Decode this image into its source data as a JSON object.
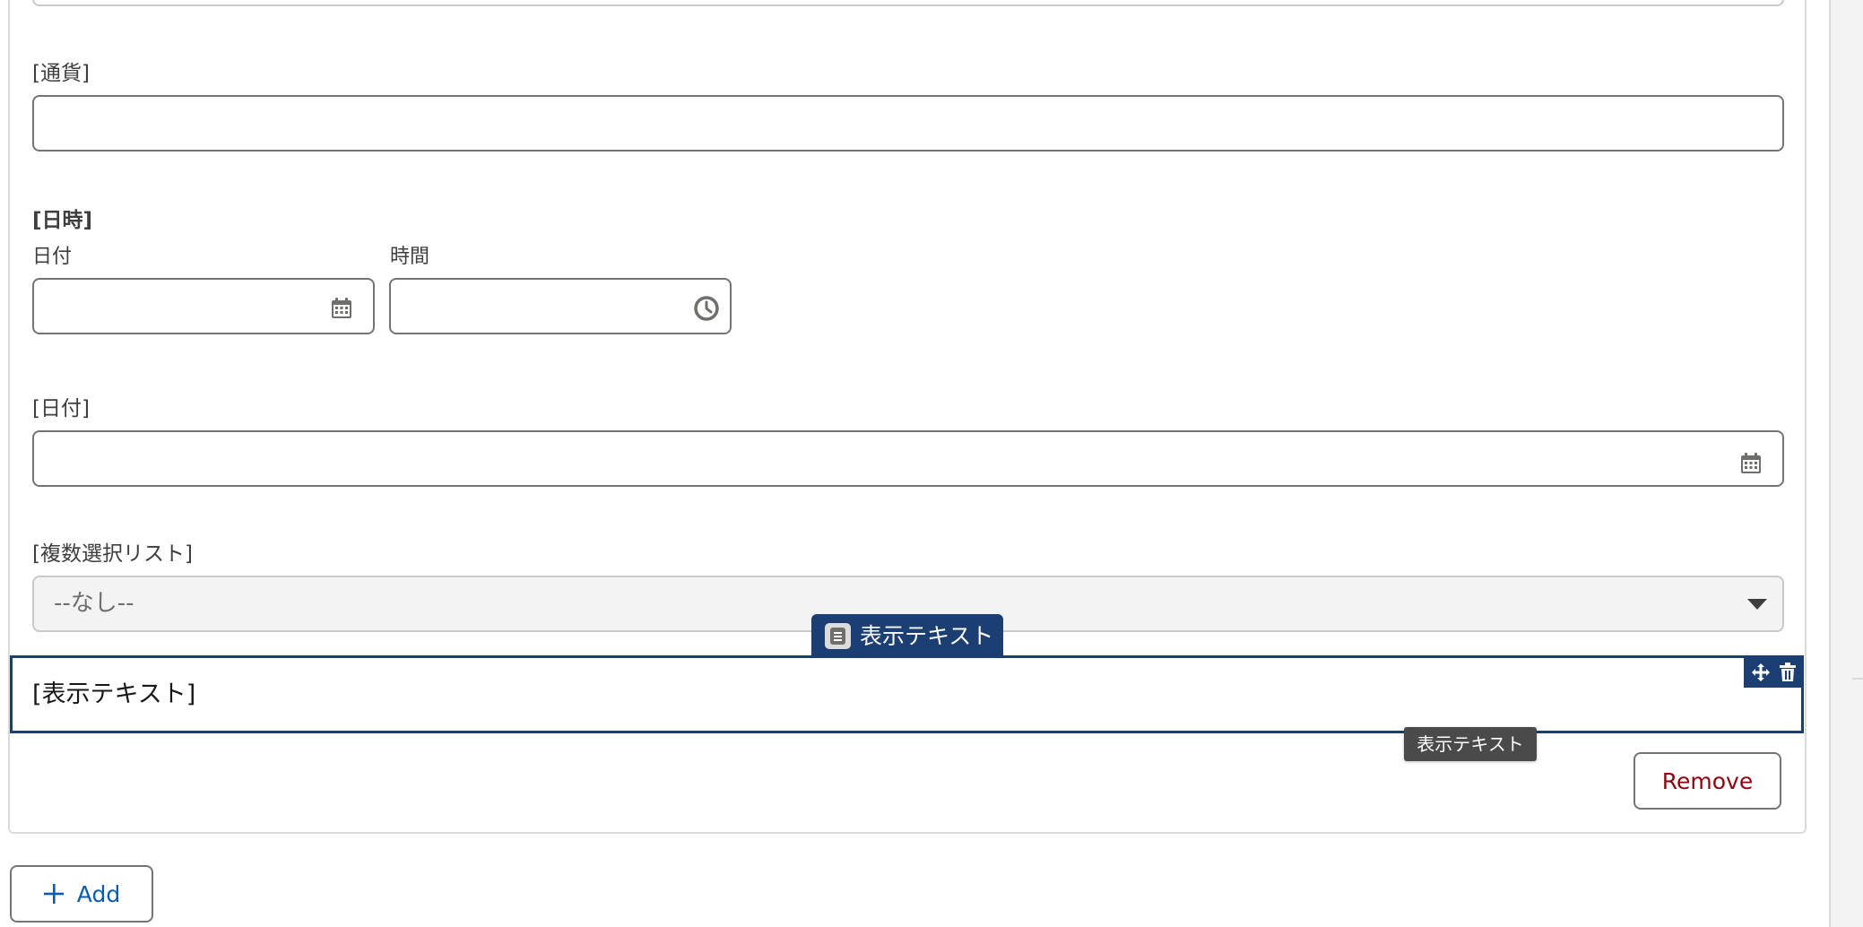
{
  "fields": {
    "currency": {
      "label": "[通貨]",
      "value": ""
    },
    "datetime": {
      "label": "[日時]",
      "date_label": "日付",
      "time_label": "時間",
      "date_value": "",
      "time_value": ""
    },
    "date": {
      "label": "[日付]",
      "value": ""
    },
    "multiselect": {
      "label": "[複数選択リスト]",
      "selected": "--なし--"
    }
  },
  "display_text_component": {
    "badge_label": "表示テキスト",
    "content": "[表示テキスト]",
    "tooltip": "表示テキスト"
  },
  "buttons": {
    "remove": "Remove",
    "add": "Add"
  },
  "colors": {
    "brand_dark": "#1b3e73",
    "remove_text": "#8e030f",
    "link_blue": "#0b5cab",
    "icon_gray": "#706e6b"
  },
  "icons": {
    "date_picker": "calendar-icon",
    "time_picker": "clock-icon",
    "dropdown": "caret-down-icon",
    "badge": "document-icon",
    "move": "move-icon",
    "delete": "trash-icon",
    "add": "plus-icon"
  }
}
